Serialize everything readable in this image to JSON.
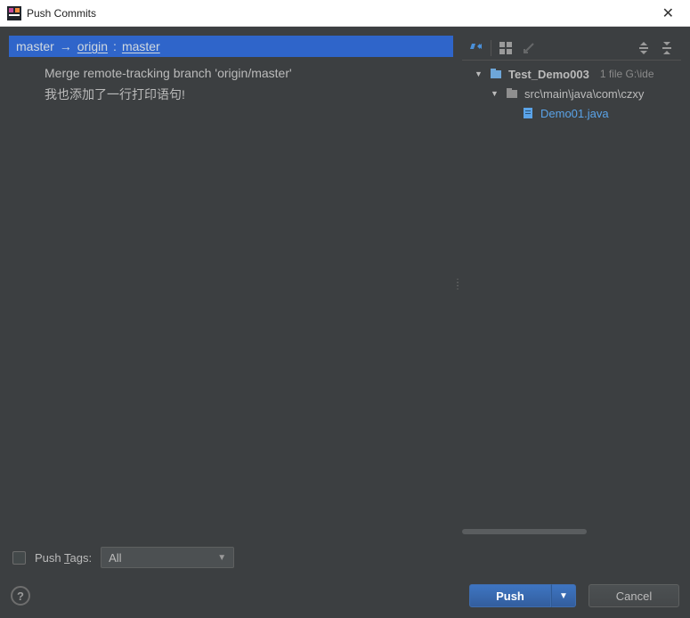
{
  "window": {
    "title": "Push Commits"
  },
  "branch": {
    "local": "master",
    "arrow": "→",
    "remote": "origin",
    "colon": " : ",
    "remoteBranch": "master"
  },
  "commits": [
    "Merge remote-tracking branch 'origin/master'",
    "我也添加了一行打印语句!"
  ],
  "tree": {
    "root": {
      "label": "Test_Demo003",
      "meta": "1 file  G:\\ide"
    },
    "folder": {
      "label": "src\\main\\java\\com\\czxy"
    },
    "file": {
      "label": "Demo01.java"
    }
  },
  "pushTags": {
    "label_pre": "Push ",
    "label_mnemonic": "T",
    "label_post": "ags:",
    "selected": "All"
  },
  "buttons": {
    "push": "Push",
    "cancel": "Cancel"
  }
}
